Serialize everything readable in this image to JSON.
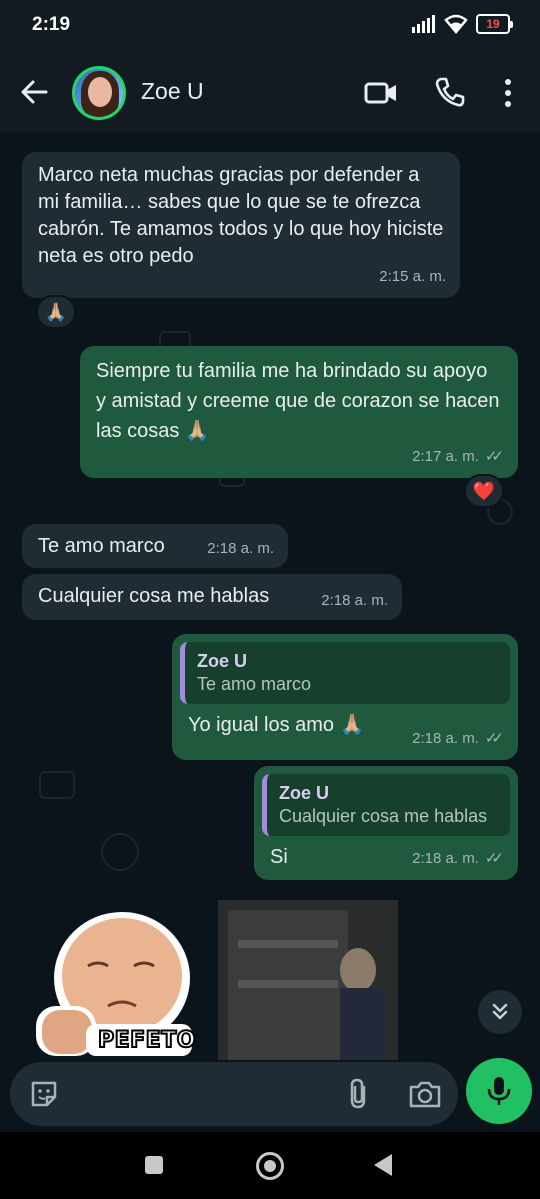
{
  "status_bar": {
    "time": "2:19",
    "battery": "19"
  },
  "contact": {
    "name": "Zoe U"
  },
  "messages": [
    {
      "id": "m1",
      "direction": "incoming",
      "text": "Marco neta muchas gracias por defender a mi familia… sabes que lo que se te ofrezca cabrón. Te amamos todos y lo que hoy hiciste neta es otro pedo",
      "time": "2:15 a. m.",
      "reaction": "🙏🏼"
    },
    {
      "id": "m2",
      "direction": "outgoing",
      "text": "Siempre tu familia me ha brindado su apoyo y amistad y creeme que de corazon se hacen las cosas 🙏🏼",
      "time": "2:17 a. m.",
      "reaction": "❤️"
    },
    {
      "id": "m3",
      "direction": "incoming",
      "text": "Te amo marco",
      "time": "2:18 a. m."
    },
    {
      "id": "m4",
      "direction": "incoming",
      "text": "Cualquier cosa me hablas",
      "time": "2:18 a. m."
    },
    {
      "id": "m5",
      "direction": "outgoing",
      "quote_author": "Zoe U",
      "quote_text": "Te amo marco",
      "text": "Yo igual los amo 🙏🏼",
      "time": "2:18 a. m."
    },
    {
      "id": "m6",
      "direction": "outgoing",
      "quote_author": "Zoe U",
      "quote_text": "Cualquier cosa me hablas",
      "text": "Si",
      "time": "2:18 a. m."
    }
  ],
  "sticker": {
    "text": "PEFETO"
  },
  "input": {
    "placeholder": ""
  },
  "icons": {
    "back": "arrow-left-icon",
    "video": "video-camera-icon",
    "call": "phone-icon",
    "more": "more-vertical-icon",
    "emoji": "sticker-icon",
    "attach": "paperclip-icon",
    "camera": "camera-icon",
    "mic": "microphone-icon",
    "scroll": "double-chevron-down-icon"
  },
  "colors": {
    "accent": "#21c063",
    "outgoing_bubble": "#1f5a3e",
    "incoming_bubble": "#202c33",
    "quote_bar": "#a689e0"
  }
}
